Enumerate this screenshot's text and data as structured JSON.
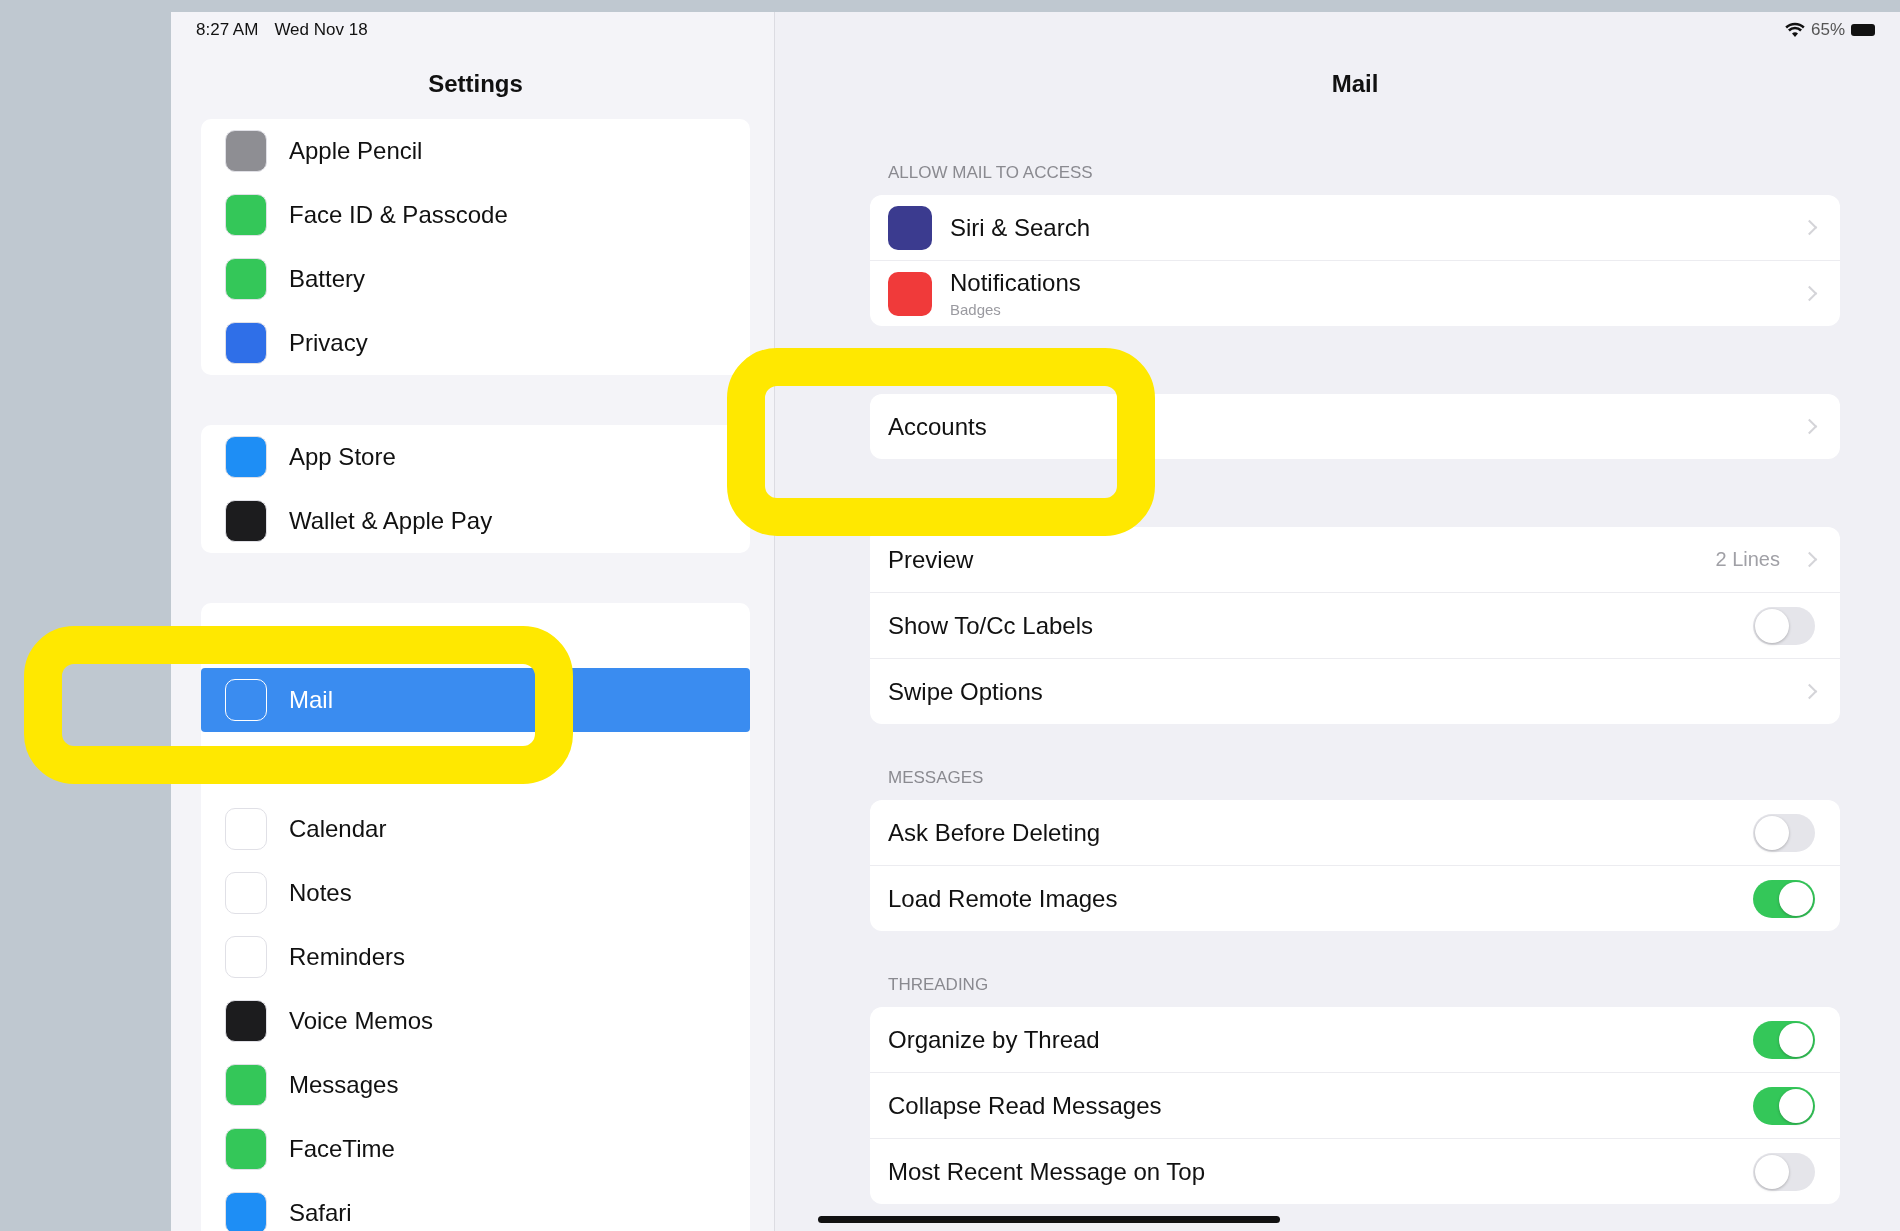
{
  "status_bar": {
    "time": "8:27 AM",
    "date": "Wed Nov 18",
    "battery": "65%"
  },
  "sidebar": {
    "title": "Settings",
    "groups": [
      {
        "items": [
          {
            "label": "Apple Pencil",
            "color": "#8e8e93",
            "selected": false
          },
          {
            "label": "Face ID & Passcode",
            "color": "#34c759",
            "selected": false
          },
          {
            "label": "Battery",
            "color": "#34c759",
            "selected": false
          },
          {
            "label": "Privacy",
            "color": "#2f6fe8",
            "selected": false
          }
        ]
      },
      {
        "items": [
          {
            "label": "App Store",
            "color": "#1e8ef5",
            "selected": false
          },
          {
            "label": "Wallet & Apple Pay",
            "color": "#1c1c1e",
            "selected": false
          }
        ]
      },
      {
        "items": [
          {
            "label": "Mail",
            "color": "#3a8cf0",
            "selected": true
          },
          {
            "label": "Calendar",
            "color": "#ffffff",
            "selected": false
          },
          {
            "label": "Notes",
            "color": "#ffffff",
            "selected": false
          },
          {
            "label": "Reminders",
            "color": "#ffffff",
            "selected": false
          },
          {
            "label": "Voice Memos",
            "color": "#1c1c1e",
            "selected": false
          },
          {
            "label": "Messages",
            "color": "#34c759",
            "selected": false
          },
          {
            "label": "FaceTime",
            "color": "#34c759",
            "selected": false
          },
          {
            "label": "Safari",
            "color": "#1e8ef5",
            "selected": false
          }
        ]
      }
    ]
  },
  "detail": {
    "title": "Mail",
    "sections": [
      {
        "header": "ALLOW MAIL TO ACCESS",
        "rows": [
          {
            "kind": "link",
            "label": "Siri & Search",
            "color": "#3b3b8f"
          },
          {
            "kind": "link",
            "label": "Notifications",
            "subtitle": "Badges",
            "color": "#f03a3a"
          }
        ]
      },
      {
        "rows": [
          {
            "kind": "link",
            "label": "Accounts"
          }
        ]
      },
      {
        "rows": [
          {
            "kind": "value",
            "label": "Preview",
            "value": "2 Lines"
          },
          {
            "kind": "toggle",
            "label": "Show To/Cc Labels",
            "on": false
          },
          {
            "kind": "link",
            "label": "Swipe Options"
          }
        ]
      },
      {
        "header": "MESSAGES",
        "rows": [
          {
            "kind": "toggle",
            "label": "Ask Before Deleting",
            "on": false
          },
          {
            "kind": "toggle",
            "label": "Load Remote Images",
            "on": true
          }
        ]
      },
      {
        "header": "THREADING",
        "rows": [
          {
            "kind": "toggle",
            "label": "Organize by Thread",
            "on": true
          },
          {
            "kind": "toggle",
            "label": "Collapse Read Messages",
            "on": true
          },
          {
            "kind": "toggle",
            "label": "Most Recent Message on Top",
            "on": false
          }
        ]
      }
    ]
  }
}
